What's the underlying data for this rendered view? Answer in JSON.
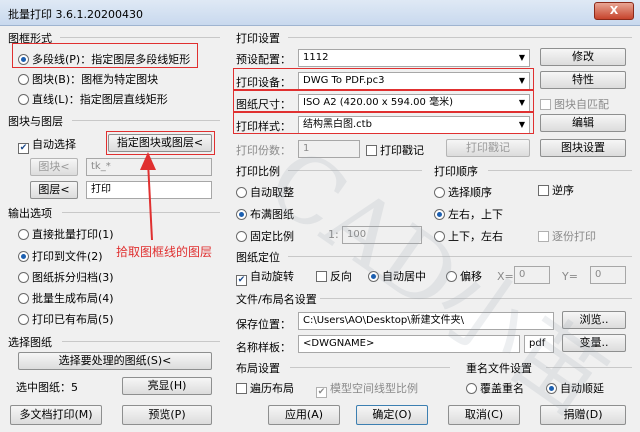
{
  "window": {
    "title": "批量打印 3.6.1.20200430",
    "close_label": "X"
  },
  "frame": {
    "heading": "图框形式",
    "options": [
      {
        "label": "多段线(P)：指定图层多段线矩形",
        "checked": true
      },
      {
        "label": "图块(B)：图框为特定图块",
        "checked": false
      },
      {
        "label": "直线(L)：指定图层直线矩形",
        "checked": false
      }
    ]
  },
  "block_layer": {
    "heading": "图块与图层",
    "auto_select_label": "自动选择",
    "auto_select_checked": true,
    "pick_button": "指定图块或图层<",
    "block_button": "图块<",
    "block_value": "tk_*",
    "layer_button": "图层<",
    "layer_value": "打印"
  },
  "output": {
    "heading": "输出选项",
    "options": [
      {
        "label": "直接批量打印(1)",
        "checked": false
      },
      {
        "label": "打印到文件(2)",
        "checked": true
      },
      {
        "label": "图纸拆分归档(3)",
        "checked": false
      },
      {
        "label": "批量生成布局(4)",
        "checked": false
      },
      {
        "label": "打印已有布局(5)",
        "checked": false
      }
    ]
  },
  "select_paper": {
    "heading": "选择图纸",
    "button": "选择要处理的图纸(S)<",
    "count_label": "选中图纸：5",
    "highlight_button": "亮显(H)"
  },
  "print_settings": {
    "heading": "打印设置",
    "preset_label": "预设配置：",
    "preset_value": "1112",
    "modify_button": "修改",
    "device_label": "打印设备：",
    "device_value": "DWG To PDF.pc3",
    "props_button": "特性",
    "size_label": "图纸尺寸：",
    "size_value": "ISO A2 (420.00 x 594.00 毫米)",
    "auto_match_label": "图块自匹配",
    "style_label": "打印样式：",
    "style_value": "结构黑白图.ctb",
    "edit_button": "编辑",
    "copies_label": "打印份数：",
    "copies_value": "1",
    "stamp_label": "打印戳记",
    "stamp_button": "打印戳记",
    "block_settings_button": "图块设置"
  },
  "scale": {
    "heading": "打印比例",
    "options": [
      {
        "label": "自动取整",
        "checked": false
      },
      {
        "label": "布满图纸",
        "checked": true
      },
      {
        "label": "固定比例",
        "checked": false
      }
    ],
    "fixed_prefix": "1:",
    "fixed_value": "100"
  },
  "order": {
    "heading": "打印顺序",
    "options": [
      {
        "label": "选择顺序",
        "checked": false
      },
      {
        "label": "左右，上下",
        "checked": true
      },
      {
        "label": "上下，左右",
        "checked": false
      }
    ],
    "reverse_label": "逆序",
    "reverse_print_label": "逐份打印"
  },
  "position": {
    "heading": "图纸定位",
    "auto_rotate_label": "自动旋转",
    "auto_rotate_checked": true,
    "reverse_label": "反向",
    "center_label": "自动居中",
    "offset_label": "偏移",
    "x_label": "X=",
    "x_value": "0",
    "y_label": "Y=",
    "y_value": "0"
  },
  "file": {
    "heading": "文件/布局名设置",
    "save_label": "保存位置：",
    "save_value": "C:\\Users\\AO\\Desktop\\新建文件夹\\",
    "browse_button": "浏览..",
    "name_label": "名称样板：",
    "name_value": "<DWGNAME>",
    "ext_value": "pdf",
    "vars_button": "变量.."
  },
  "layout": {
    "heading": "布局设置",
    "all_layouts_label": "遍历布局",
    "model_scale_label": "模型空间线型比例"
  },
  "rename": {
    "heading": "重名文件设置",
    "overwrite_label": "覆盖重名",
    "auto_number_label": "自动顺延"
  },
  "buttons": {
    "multi_doc": "多文档打印(M)",
    "preview": "预览(P)",
    "apply": "应用(A)",
    "ok": "确定(O)",
    "cancel": "取消(C)",
    "donate": "捐赠(D)"
  },
  "annotation": {
    "text": "拾取图框线的图层",
    "color": "#e03030"
  },
  "watermark": {
    "text": "CAD小苗"
  }
}
